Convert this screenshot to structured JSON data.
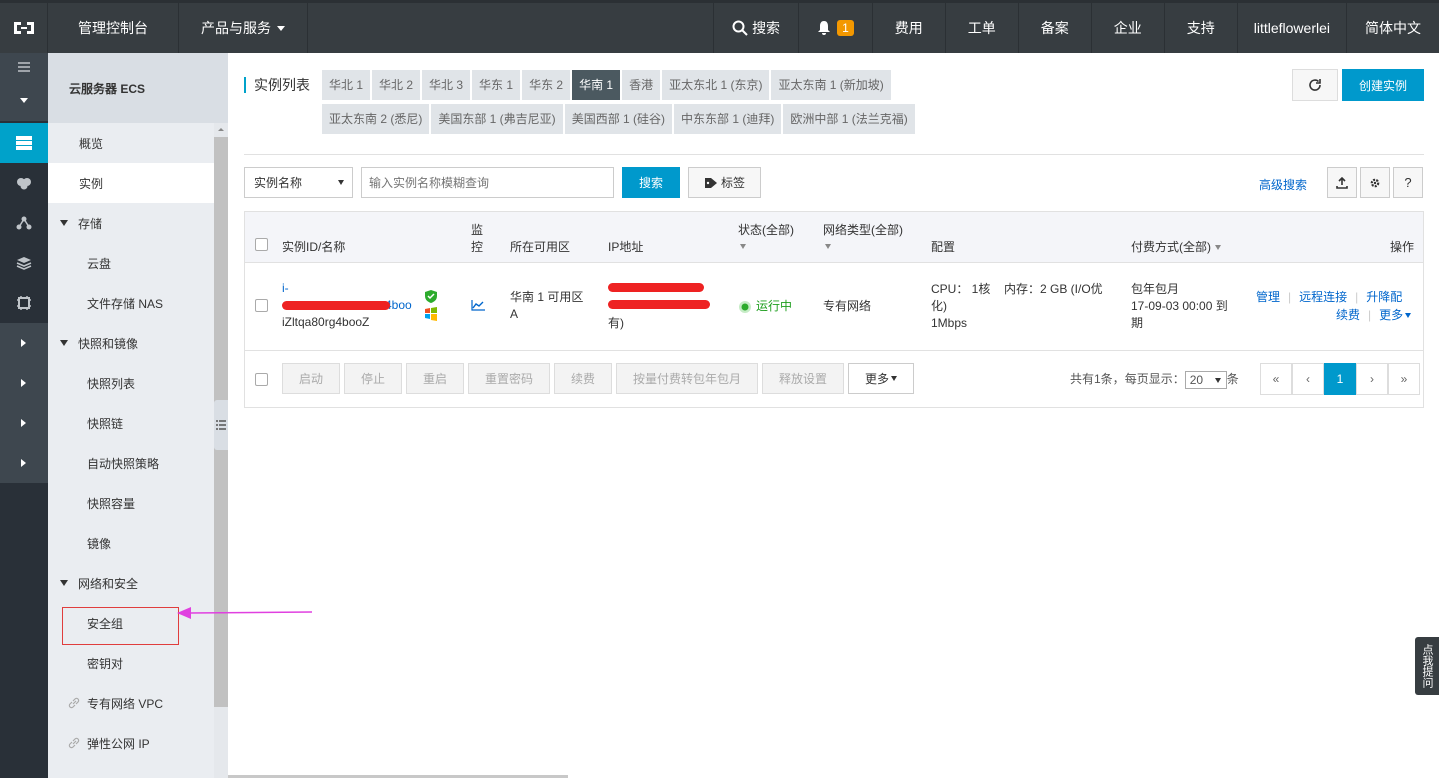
{
  "topbar": {
    "console": "管理控制台",
    "products": "产品与服务",
    "search": "搜索",
    "notifications": "1",
    "fees": "费用",
    "tickets": "工单",
    "beian": "备案",
    "enterprise": "企业",
    "support": "支持",
    "user": "littleflowerlei",
    "language": "简体中文"
  },
  "sidebar": {
    "title": "云服务器 ECS",
    "items": {
      "overview": "概览",
      "instances": "实例",
      "storage": "存储",
      "disk": "云盘",
      "nas": "文件存储 NAS",
      "snapshots": "快照和镜像",
      "snapshot_list": "快照列表",
      "snapshot_chain": "快照链",
      "auto_snapshot": "自动快照策略",
      "snapshot_capacity": "快照容量",
      "images": "镜像",
      "network_security": "网络和安全",
      "security_group": "安全组",
      "key_pairs": "密钥对",
      "vpc": "专有网络 VPC",
      "eip": "弹性公网 IP"
    }
  },
  "main": {
    "region_label": "实例列表",
    "regions": [
      "华北 1",
      "华北 2",
      "华北 3",
      "华东 1",
      "华东 2",
      "华南 1",
      "香港",
      "亚太东北 1 (东京)",
      "亚太东南 1 (新加坡)",
      "亚太东南 2 (悉尼)",
      "美国东部 1 (弗吉尼亚)",
      "美国西部 1 (硅谷)",
      "中东东部 1 (迪拜)",
      "欧洲中部 1 (法兰克福)"
    ],
    "selected_region": "华南 1",
    "create_button": "创建实例",
    "search_type": "实例名称",
    "search_placeholder": "输入实例名称模糊查询",
    "search_button": "搜索",
    "tag_button": "标签",
    "advanced_search": "高级搜索",
    "help": "?"
  },
  "table": {
    "headers": {
      "id": "实例ID/名称",
      "monitor_1": "监",
      "monitor_2": "控",
      "zone": "所在可用区",
      "ip": "IP地址",
      "status": "状态(全部)",
      "network": "网络类型(全部)",
      "config": "配置",
      "billing": "付费方式(全部)",
      "actions": "操作"
    },
    "row": {
      "id_prefix": "i-",
      "id_tail": "4boo",
      "name": "iZltqa80rg4booZ",
      "zone_1": "华南 1 可用区",
      "zone_2": "A",
      "ip_private_suffix": "有)",
      "status": "运行中",
      "network": "专有网络",
      "cpu": "CPU： 1核",
      "memory": "内存：2 GB (I/O优",
      "config_cont": "化)",
      "bandwidth": "1Mbps",
      "billing_1": "包年包月",
      "billing_2": "17-09-03 00:00 到",
      "billing_3": "期",
      "action_manage": "管理",
      "action_remote": "远程连接",
      "action_upgrade": "升降配",
      "action_renew": "续费",
      "action_more": "更多"
    },
    "footer": {
      "start": "启动",
      "stop": "停止",
      "restart": "重启",
      "reset_password": "重置密码",
      "renew": "续费",
      "convert": "按量付费转包年包月",
      "release": "释放设置",
      "more": "更多",
      "total": "共有1条，",
      "per_page_label": "每页显示：",
      "per_page": "20",
      "per_page_unit": "条",
      "current_page": "1"
    }
  },
  "feedback": "点我提问"
}
